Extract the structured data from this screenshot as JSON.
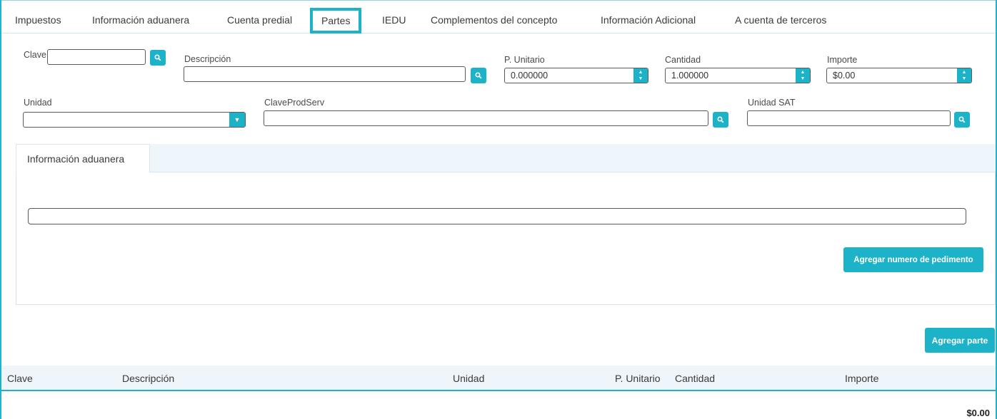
{
  "tabs": {
    "items": [
      "Impuestos",
      "Información aduanera",
      "Cuenta predial",
      "Partes",
      "IEDU",
      "Complementos del concepto",
      "Información Adicional",
      "A cuenta de terceros"
    ],
    "active": "Partes"
  },
  "form": {
    "clave_label": "Clave",
    "clave_value": "",
    "descripcion_label": "Descripción",
    "descripcion_value": "",
    "punitario_label": "P. Unitario",
    "punitario_value": "0.000000",
    "cantidad_label": "Cantidad",
    "cantidad_value": "1.000000",
    "importe_label": "Importe",
    "importe_value": "$0.00",
    "unidad_label": "Unidad",
    "unidad_value": "",
    "claveprodserv_label": "ClaveProdServ",
    "claveprodserv_value": "",
    "unidadsat_label": "Unidad SAT",
    "unidadsat_value": ""
  },
  "panel": {
    "tab_label": "Información aduanera",
    "pedimento_value": "",
    "add_pedimento_label": "Agregar numero de pedimento"
  },
  "add_parte_label": "Agregar parte",
  "table": {
    "headers": [
      "Clave",
      "Descripción",
      "Unidad",
      "P. Unitario",
      "Cantidad",
      "Importe"
    ],
    "total": "$0.00"
  },
  "colors": {
    "accent": "#1cb2c8",
    "header_bg": "#eef5fb"
  },
  "icons": {
    "search": "search-icon",
    "spinner": "spinner-arrows-icon",
    "dropdown": "chevron-down-icon"
  }
}
